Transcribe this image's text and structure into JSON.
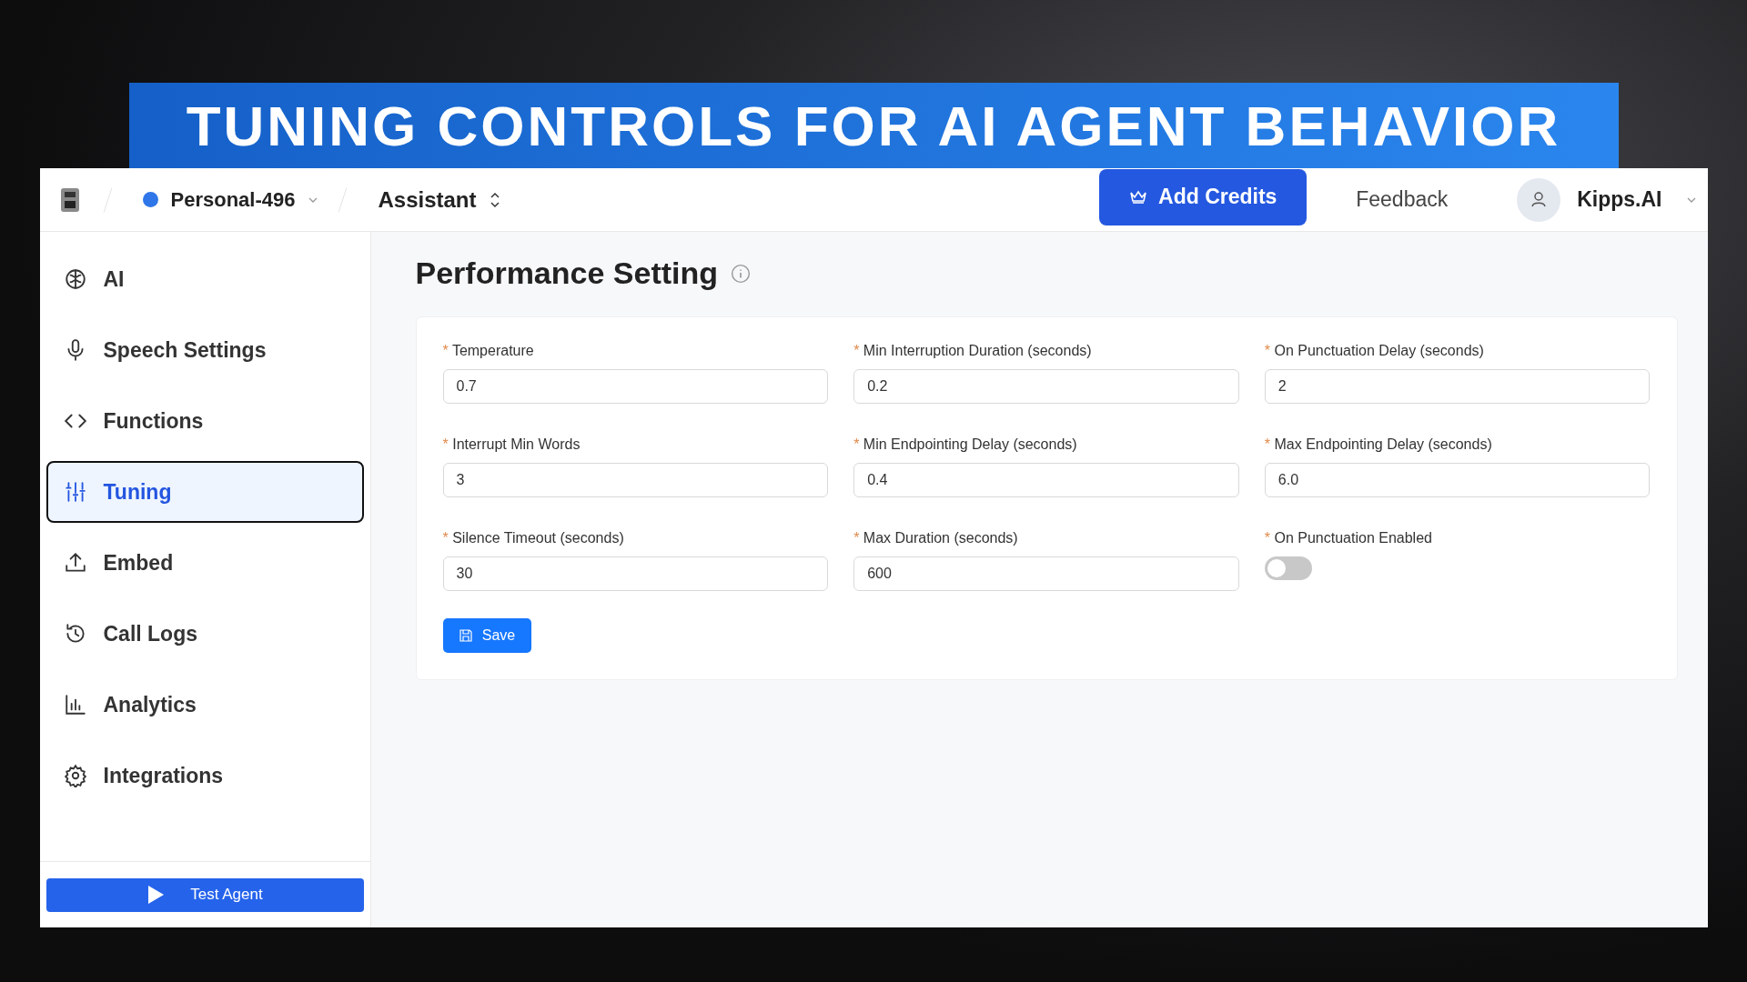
{
  "banner": {
    "title": "TUNING CONTROLS FOR AI AGENT BEHAVIOR"
  },
  "header": {
    "workspace": "Personal-496",
    "assistant": "Assistant",
    "add_credits": "Add Credits",
    "feedback": "Feedback",
    "user": "Kipps.AI"
  },
  "sidebar": {
    "items": [
      {
        "label": "AI",
        "selected": false
      },
      {
        "label": "Speech Settings",
        "selected": false
      },
      {
        "label": "Functions",
        "selected": false
      },
      {
        "label": "Tuning",
        "selected": true
      },
      {
        "label": "Embed",
        "selected": false
      },
      {
        "label": "Call Logs",
        "selected": false
      },
      {
        "label": "Analytics",
        "selected": false
      },
      {
        "label": "Integrations",
        "selected": false
      }
    ],
    "test_agent": "Test Agent"
  },
  "page": {
    "title": "Performance Setting",
    "fields": [
      {
        "kind": "input",
        "required_mark": "*",
        "label": "Temperature",
        "value": "0.7"
      },
      {
        "kind": "input",
        "required_mark": "*",
        "label": "Min Interruption Duration (seconds)",
        "value": "0.2"
      },
      {
        "kind": "input",
        "required_mark": "*",
        "label": "On Punctuation Delay (seconds)",
        "value": "2"
      },
      {
        "kind": "input",
        "required_mark": "*",
        "label": "Interrupt Min Words",
        "value": "3"
      },
      {
        "kind": "input",
        "required_mark": "*",
        "label": "Min Endpointing Delay (seconds)",
        "value": "0.4"
      },
      {
        "kind": "input",
        "required_mark": "*",
        "label": "Max Endpointing Delay (seconds)",
        "value": "6.0"
      },
      {
        "kind": "input",
        "required_mark": "*",
        "label": "Silence Timeout (seconds)",
        "value": "30"
      },
      {
        "kind": "input",
        "required_mark": "*",
        "label": "Max Duration (seconds)",
        "value": "600"
      },
      {
        "kind": "toggle",
        "required_mark": "*",
        "label": "On Punctuation Enabled",
        "on": false
      }
    ],
    "save": "Save"
  }
}
